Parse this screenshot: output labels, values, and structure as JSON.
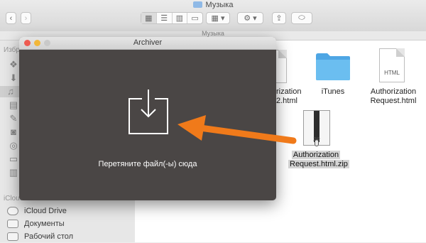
{
  "finder": {
    "window_title": "Музыка",
    "path_label": "Музыка",
    "sidebar": {
      "favorites_header": "Избр",
      "icloud_header": "iCloud",
      "items": [
        {
          "label": "iCloud Drive"
        },
        {
          "label": "Документы"
        },
        {
          "label": "Рабочий стол"
        }
      ]
    },
    "files": {
      "partial_label": "rization\n2.html",
      "itunes": "iTunes",
      "auth_html": "Authorization\nRequest.html",
      "auth_html_type": "HTML",
      "zip_label_1": "Authorization",
      "zip_label_2": "Request.html.zip",
      "zip_type": "ZIP"
    }
  },
  "archiver": {
    "title": "Archiver",
    "drop_hint": "Перетяните файл(-ы) сюда"
  },
  "colors": {
    "accent_arrow": "#f07a1a",
    "folder_blue": "#5aaee8",
    "archiver_bg": "#4a4645"
  }
}
